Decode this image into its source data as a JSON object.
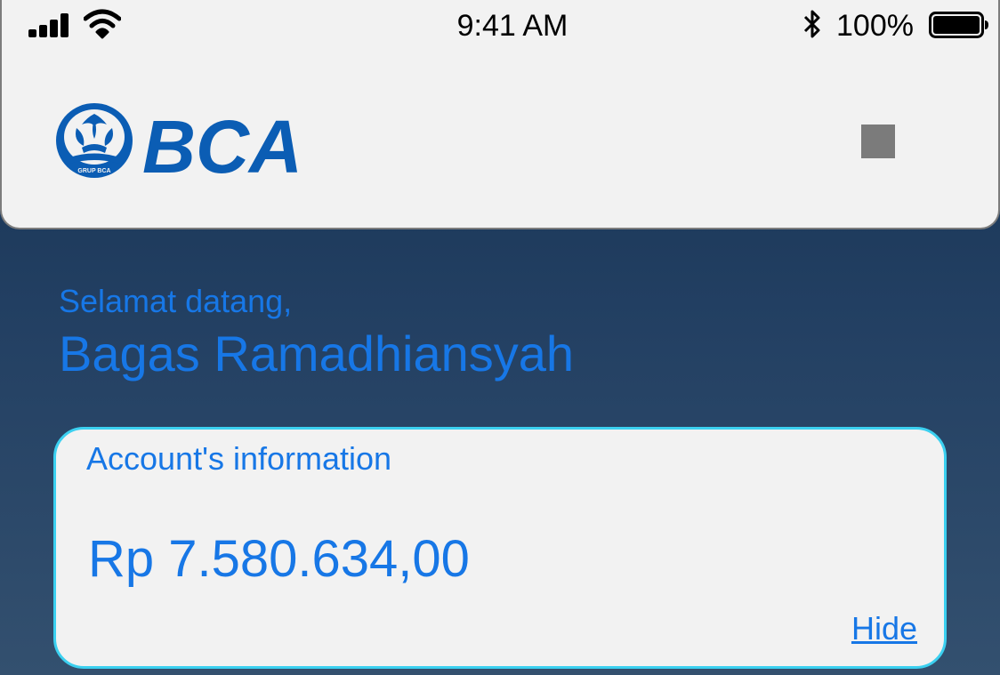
{
  "status_bar": {
    "time": "9:41 AM",
    "battery_percent": "100%",
    "icons": [
      "signal-icon",
      "wifi-icon",
      "bluetooth-icon",
      "battery-icon"
    ]
  },
  "header": {
    "logo_text": "BCA",
    "logo_subtext": "GRUP BCA",
    "menu_icon": "menu-square-icon"
  },
  "welcome": {
    "greeting": "Selamat datang,",
    "name": "Bagas Ramadhiansyah"
  },
  "account": {
    "title": "Account's information",
    "balance": "Rp 7.580.634,00",
    "hide_label": "Hide"
  },
  "colors": {
    "accent": "#1777e6",
    "brand_blue": "#0b5db4",
    "card_border": "#3bd0f0",
    "background_top": "#14304f",
    "background_bottom": "#33506f"
  }
}
